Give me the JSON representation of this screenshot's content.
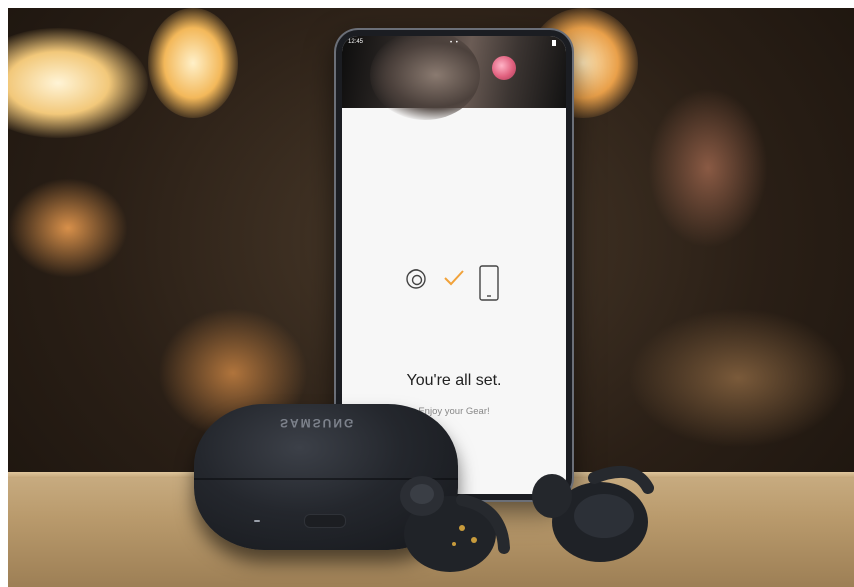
{
  "phone": {
    "status_time": "12:45",
    "status_dots": "• •",
    "screen": {
      "title": "You're all set.",
      "subtitle": "Enjoy your Gear!",
      "icons": [
        "earbud-icon",
        "check-icon",
        "phone-icon"
      ],
      "check_color": "#f1a23a"
    }
  },
  "case": {
    "brand_text": "SAMSUNG"
  },
  "colors": {
    "screen_bg": "#f7f7f7",
    "device_black": "#1b1d22",
    "accent": "#f1a23a"
  }
}
